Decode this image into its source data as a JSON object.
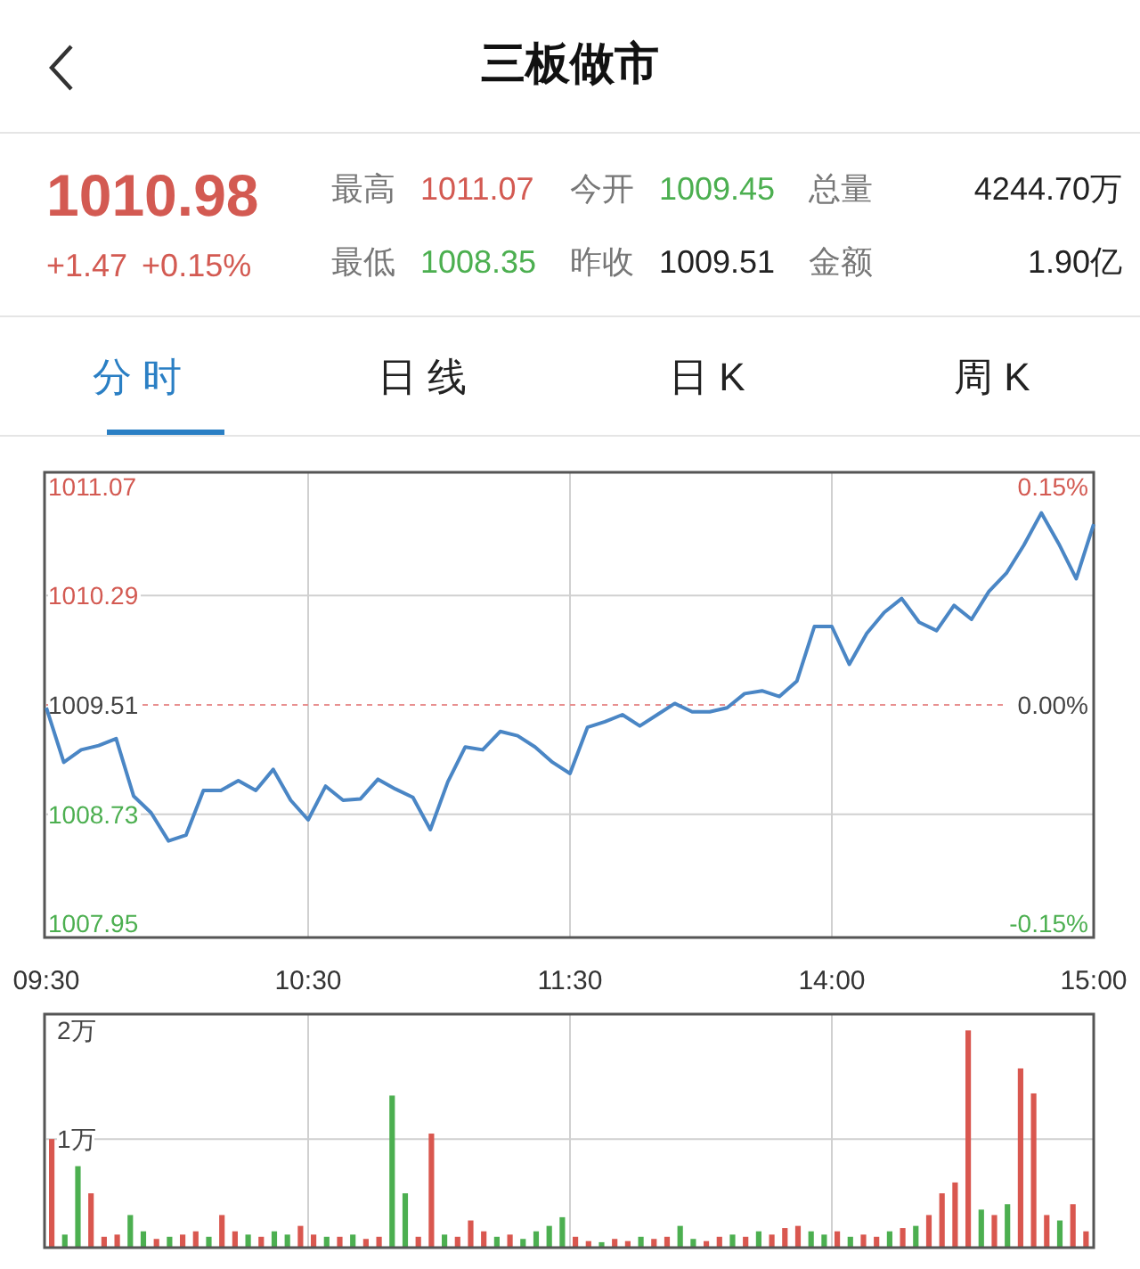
{
  "header": {
    "title": "三板做市"
  },
  "quote": {
    "price": "1010.98",
    "change": "+1.47",
    "change_percent": "+0.15%",
    "stats": [
      {
        "label": "最高",
        "value": "1011.07",
        "color": "#d35a52"
      },
      {
        "label": "今开",
        "value": "1009.45",
        "color": "#4caf50"
      },
      {
        "label": "总量",
        "value": "4244.70万",
        "color": "#222222"
      },
      {
        "label": "最低",
        "value": "1008.35",
        "color": "#4caf50"
      },
      {
        "label": "昨收",
        "value": "1009.51",
        "color": "#222222"
      },
      {
        "label": "金额",
        "value": "1.90亿",
        "color": "#222222"
      }
    ]
  },
  "tabs": [
    {
      "label": "分时",
      "selected": true
    },
    {
      "label": "日线",
      "selected": false
    },
    {
      "label": "日K",
      "selected": false
    },
    {
      "label": "周K",
      "selected": false
    }
  ],
  "price_chart": {
    "percent_labels": [
      {
        "text": "0.15%",
        "color": "#d35a52"
      },
      {
        "text": "0.00%",
        "color": "#444444"
      },
      {
        "text": "-0.15%",
        "color": "#4caf50"
      }
    ],
    "chart_data": {
      "type": "line",
      "categories": [
        "09:30",
        null,
        null,
        null,
        null,
        null,
        null,
        null,
        null,
        null,
        null,
        null,
        null,
        null,
        null,
        "10:30",
        null,
        null,
        null,
        null,
        null,
        null,
        null,
        null,
        null,
        null,
        null,
        null,
        null,
        null,
        "11:30",
        null,
        null,
        null,
        null,
        null,
        null,
        null,
        null,
        null,
        null,
        null,
        null,
        null,
        null,
        "14:00",
        null,
        null,
        null,
        null,
        null,
        null,
        null,
        null,
        null,
        null,
        null,
        null,
        null,
        null,
        "15:00"
      ],
      "series": [
        {
          "color": "#4a86c5",
          "values": [
            1009.49,
            1009.1,
            1009.19,
            1009.22,
            1009.27,
            1008.86,
            1008.74,
            1008.54,
            1008.58,
            1008.9,
            1008.9,
            1008.97,
            1008.9,
            1009.05,
            1008.83,
            1008.69,
            1008.93,
            1008.83,
            1008.84,
            1008.98,
            1008.91,
            1008.85,
            1008.62,
            1008.96,
            1009.21,
            1009.19,
            1009.32,
            1009.29,
            1009.21,
            1009.1,
            1009.02,
            1009.35,
            1009.39,
            1009.44,
            1009.36,
            1009.44,
            1009.52,
            1009.46,
            1009.46,
            1009.49,
            1009.59,
            1009.61,
            1009.57,
            1009.68,
            1010.07,
            1010.07,
            1009.8,
            1010.02,
            1010.17,
            1010.27,
            1010.1,
            1010.04,
            1010.22,
            1010.12,
            1010.32,
            1010.45,
            1010.65,
            1010.88,
            1010.66,
            1010.41,
            1010.8
          ]
        }
      ],
      "ylim": [
        1007.85,
        1011.17
      ],
      "grid": true,
      "ref_lines": [
        {
          "axis": "y",
          "value": 1009.51
        }
      ],
      "yticks": [
        {
          "value": 1011.07,
          "label": "1011.07"
        },
        {
          "value": 1010.29,
          "label": "1010.29"
        },
        {
          "value": 1009.51,
          "label": "1009.51"
        },
        {
          "value": 1008.73,
          "label": "1008.73"
        },
        {
          "value": 1007.95,
          "label": "1007.95"
        }
      ]
    }
  },
  "volume_chart": {
    "chart_data": {
      "type": "bar",
      "stacked": true,
      "series": [
        {
          "color": "#d9574f",
          "values": [
            1.0,
            null,
            null,
            0.5,
            0.1,
            0.12,
            null,
            null,
            0.08,
            null,
            0.12,
            0.15,
            null,
            0.3,
            0.15,
            null,
            0.1,
            null,
            null,
            0.2,
            0.12,
            null,
            0.1,
            null,
            0.08,
            0.1,
            null,
            null,
            0.1,
            1.05,
            null,
            0.1,
            0.25,
            0.15,
            null,
            0.12,
            null,
            null,
            null,
            null,
            0.1,
            0.06,
            null,
            0.08,
            0.06,
            null,
            0.08,
            0.1,
            null,
            null,
            0.06,
            0.1,
            null,
            0.1,
            null,
            0.12,
            0.18,
            0.2,
            null,
            null,
            0.15,
            null,
            0.12,
            0.1,
            null,
            0.18,
            null,
            0.3,
            0.5,
            0.6,
            2.0,
            null,
            0.3,
            null,
            1.65,
            1.42,
            0.3,
            null,
            0.4,
            0.15
          ]
        },
        {
          "color": "#4caf50",
          "values": [
            null,
            0.12,
            0.75,
            null,
            null,
            null,
            0.3,
            0.15,
            null,
            0.1,
            null,
            null,
            0.1,
            null,
            null,
            0.12,
            null,
            0.15,
            0.12,
            null,
            null,
            0.1,
            null,
            0.12,
            null,
            null,
            1.4,
            0.5,
            null,
            null,
            0.12,
            null,
            null,
            null,
            0.1,
            null,
            0.08,
            0.15,
            0.2,
            0.28,
            null,
            null,
            0.05,
            null,
            null,
            0.1,
            null,
            null,
            0.2,
            0.08,
            null,
            null,
            0.12,
            null,
            0.15,
            null,
            null,
            null,
            0.15,
            0.12,
            null,
            0.1,
            null,
            null,
            0.15,
            null,
            0.2,
            null,
            null,
            null,
            null,
            0.35,
            null,
            0.4,
            null,
            null,
            null,
            0.25,
            null,
            null
          ]
        }
      ],
      "ylim": [
        0,
        2.15
      ],
      "grid": true,
      "yticks": [
        {
          "value": 1,
          "label": "1万"
        },
        {
          "value": 2,
          "label": "2万"
        }
      ]
    }
  }
}
